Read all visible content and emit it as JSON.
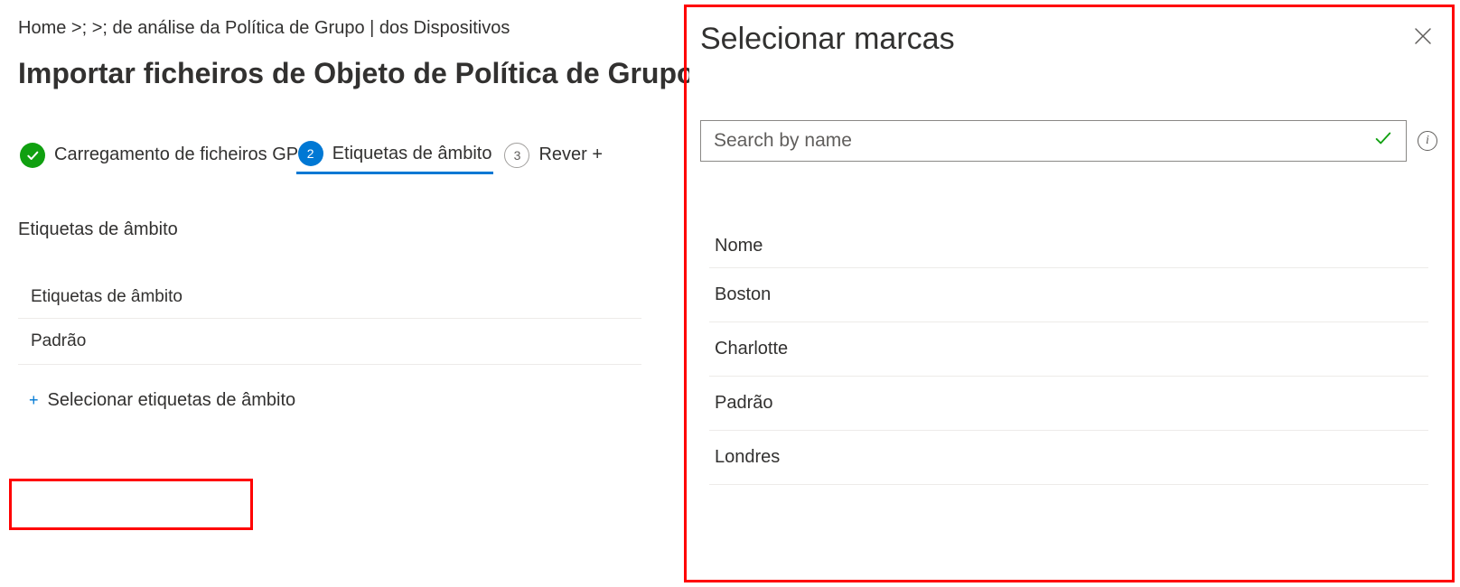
{
  "breadcrumb": "Home >;  >; de análise da Política de Grupo | dos Dispositivos",
  "page_title": "Importar ficheiros de Objeto de Política de Grupo",
  "stepper": {
    "step1": {
      "label": "Carregamento de ficheiros GPO",
      "num": ""
    },
    "step2": {
      "label": "Etiquetas de âmbito",
      "num": "2"
    },
    "step3": {
      "label": "Rever +",
      "num": "3"
    }
  },
  "main": {
    "section_heading": "Etiquetas de âmbito",
    "table_header": "Etiquetas de âmbito",
    "tag_rows": [
      "Padrão"
    ],
    "select_link": "Selecionar etiquetas de âmbito"
  },
  "side": {
    "title": "Selecionar marcas",
    "search_placeholder": "Search by name",
    "list_header": "Nome",
    "items": [
      "Boston",
      "Charlotte",
      "Padrão",
      "Londres"
    ]
  },
  "colors": {
    "accent": "#0078d4",
    "success": "#10a010",
    "highlight": "#ff0000"
  }
}
